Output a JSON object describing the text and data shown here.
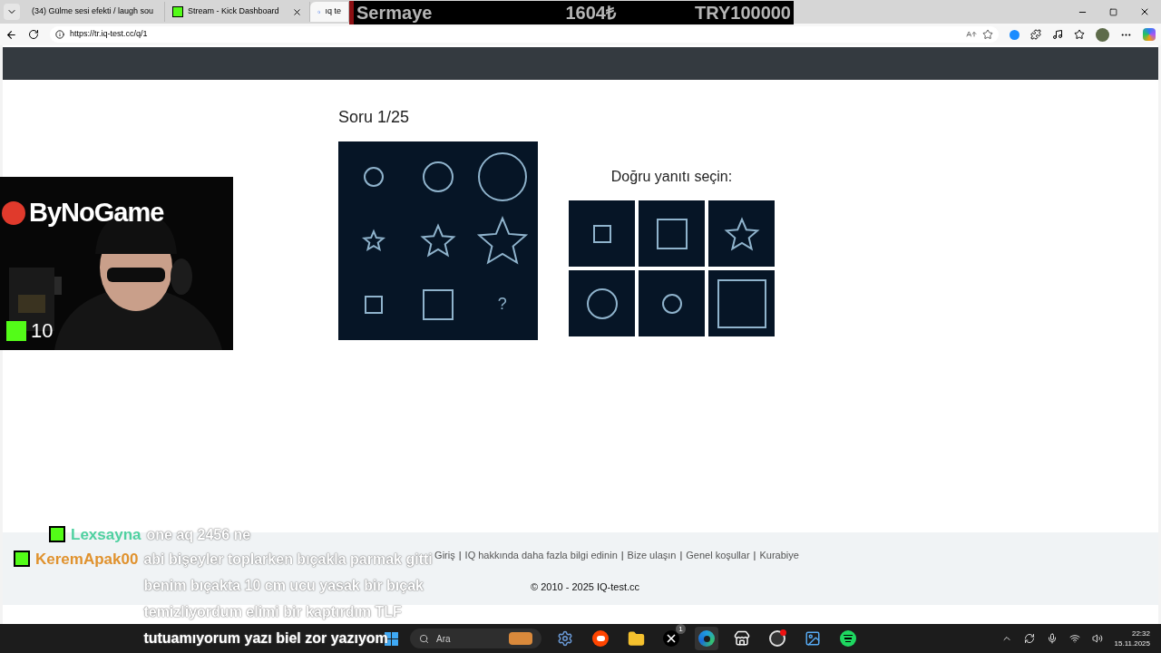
{
  "browser": {
    "tabs": [
      {
        "title": "(34) Gülme sesi efekti / laugh sou",
        "selected": false
      },
      {
        "title": "Stream - Kick Dashboard",
        "selected": false
      },
      {
        "title": "ıq te",
        "selected": true
      }
    ],
    "url": "https://tr.iq-test.cc/q/1"
  },
  "stream_banner": {
    "label": "Sermaye",
    "amount": "1604₺",
    "goal": "TRY100000"
  },
  "question": {
    "title": "Soru 1/25",
    "matrix": [
      {
        "kind": "small_circle"
      },
      {
        "kind": "medium_circle"
      },
      {
        "kind": "large_circle"
      },
      {
        "kind": "small_star"
      },
      {
        "kind": "medium_star"
      },
      {
        "kind": "large_star"
      },
      {
        "kind": "small_square"
      },
      {
        "kind": "medium_square"
      },
      {
        "kind": "question",
        "label": "?"
      }
    ],
    "answers_title": "Doğru yanıtı seçin:",
    "answers": [
      {
        "kind": "small_square"
      },
      {
        "kind": "medium_square"
      },
      {
        "kind": "medium_star"
      },
      {
        "kind": "medium_circle"
      },
      {
        "kind": "small_circle"
      },
      {
        "kind": "large_square"
      }
    ]
  },
  "footer": {
    "links": [
      "Giriş",
      "IQ hakkında daha fazla bilgi edinin",
      "Bize ulaşın",
      "Genel koşullar",
      "Kurabiye"
    ],
    "separator": "|",
    "copyright": "© 2010 - 2025 IQ-test.cc"
  },
  "webcam": {
    "channel": "ByNoGame",
    "viewers": "10"
  },
  "chat": [
    {
      "user": "Lexsayna",
      "color": "#4fd1a0",
      "lines": [
        "one aq 2456 ne"
      ]
    },
    {
      "user": "KeremApak00",
      "color": "#e0922e",
      "lines": [
        "abi bişeyler toplarken bıçakla parmak gitti",
        "benim bıçakta 10 cm ucu yasak bir bıçak",
        "temizliyordum elimi bir kaptırdım TLF",
        "tutuamıyorum yazı biel zor yazıyom"
      ]
    }
  ],
  "taskbar": {
    "search_placeholder": "Ara",
    "apps": [
      {
        "kind": "settings",
        "selected": false
      },
      {
        "kind": "reddit",
        "selected": false
      },
      {
        "kind": "folder",
        "selected": false
      },
      {
        "kind": "x",
        "badge": "1",
        "selected": false
      },
      {
        "kind": "edge",
        "selected": true
      },
      {
        "kind": "store",
        "selected": false
      },
      {
        "kind": "obs",
        "selected": false
      },
      {
        "kind": "photos",
        "selected": false
      },
      {
        "kind": "spotify",
        "selected": false
      }
    ],
    "time": "22:32",
    "date": "15.11.2025"
  }
}
